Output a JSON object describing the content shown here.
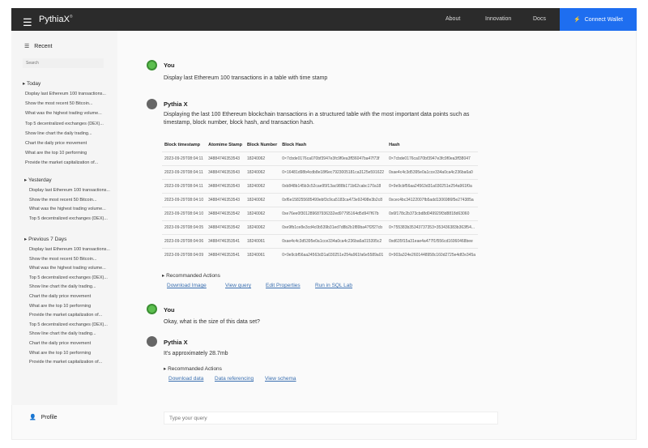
{
  "header": {
    "brand": "PythiaX",
    "brand_mark": "®",
    "nav": [
      "About",
      "Innovation",
      "Docs"
    ],
    "connect_label": "Connect Wallet",
    "accent": "#1e6ef0"
  },
  "sidebar": {
    "title": "Recent",
    "search_placeholder": "Search",
    "groups": [
      {
        "label": "Today",
        "items": [
          "Display last Ethereum 100 transactions...",
          "Show the most recent 50 Bitcoin...",
          "What was the highest trading volume...",
          "Top 5 decentralized exchanges (DEX)...",
          "Show line chart the daily trading...",
          "Chart the daily price movement",
          "What are the top 10 performing",
          "Provide the market capitalization of..."
        ]
      },
      {
        "label": "Yesterday",
        "items": [
          "Display last Ethereum 100 transactions...",
          "Show the most recent 50 Bitcoin...",
          "What was the highest trading volume...",
          "Top 5 decentralized exchanges (DEX)..."
        ]
      },
      {
        "label": "Previous 7 Days",
        "items": [
          "Display last Ethereum 100 transactions...",
          "Show the most recent 50 Bitcoin...",
          "What was the highest trading volume...",
          "Top 5 decentralized exchanges (DEX)...",
          "Show line chart the daily trading...",
          "Chart the daily price movement",
          "What are the top 10 performing",
          "Provide the market capitalization of...",
          "Top 5 decentralized exchanges (DEX)...",
          "Show line chart the daily trading...",
          "Chart the daily price movement",
          "What are the top 10 performing",
          "Provide the market capitalization of..."
        ]
      }
    ],
    "profile": "Profile"
  },
  "chat": {
    "m1": {
      "who": "You",
      "text": "Display last Ethereum 100 transactions in a table with time stamp"
    },
    "m2": {
      "who": "Pythia X",
      "text": "Displaying the last 100 Ethereum blockchain transactions in a structured table with the most important data points such as timestamp, block number, block hash, and transaction hash."
    },
    "table": {
      "columns": [
        "Block timestamp",
        "Atomime Stamp",
        "Block Number",
        "Block Hash",
        "Hash"
      ],
      "rows": [
        [
          "2023-09-29T08:04:11",
          "34884746353543",
          "18240062",
          "0×7cbde0176ca070bf3947e3fc9f0ea3ff36047ba47f73f",
          "0×7cbde0176ca070bf3947e3fc9f0ea3ff38047"
        ],
        [
          "2023-09-29T08:04:11",
          "34884746353543",
          "18240062",
          "0×16481d98b4cdb8e18f6ec7923005181ca3125e591622",
          "0xae4c4c3d5395e0a1cce334a0ca4c236ba6a0"
        ],
        [
          "2023-09-29T08:04:11",
          "34884746353543",
          "18240062",
          "0xb848b145b3c52cae95f13ac988b171b62cabc170a18",
          "0×9e9cbf56aa24563d31a030251e254a961f0a"
        ],
        [
          "2023-09-29T08:04:10",
          "34884746353543",
          "18240062",
          "0xf6e158255685499ebf3c9ca5183ca473e92498e3b2c8",
          "0xcec4bc34122007fb5add1306986f5e274385a"
        ],
        [
          "2023-09-29T08:04:10",
          "34884746353542",
          "18240062",
          "0xe76ee0f301289687936332ed97795164d5d947f67b",
          "0x6f178c2b373cbd8d049929f3d8818d63060"
        ],
        [
          "2023-09-29T08:04:05",
          "34884746353542",
          "18240062",
          "0xe9fb1ce8e3cd4c0b539b31ed7d8b2b1f89ba47f2f27cb",
          "0×755383b35343737353×353436383b363f54..."
        ],
        [
          "2023-09-29T08:04:06",
          "34884746353541",
          "18240061",
          "0xae4c4c3d5395e0a1cce334a0ca4c236ba6a015395c2",
          "0xd635f15a31eae4a477f1f556cd16060468bee"
        ],
        [
          "2023-09-29T08:04:09",
          "34884746353541",
          "18240061",
          "0×9e9cbf56aa24563d31a030251e254a961fa6e5589a01",
          "0×903a324e2601448958c160d2725e4df2e345a"
        ]
      ]
    },
    "actions1": {
      "label": "Recommanded Actions",
      "links": [
        "Download Image",
        "View query",
        "Edit Properties",
        "Run in SQL Lab"
      ]
    },
    "m3": {
      "who": "You",
      "text": "Okay, what is the size of this data set?"
    },
    "m4": {
      "who": "Pythia X",
      "text": "It's approximately 28.7mb"
    },
    "actions2": {
      "label": "Recommanded Actions",
      "links": [
        "Download data",
        "Data referencing",
        "View schema"
      ]
    },
    "input_placeholder": "Type your query"
  }
}
